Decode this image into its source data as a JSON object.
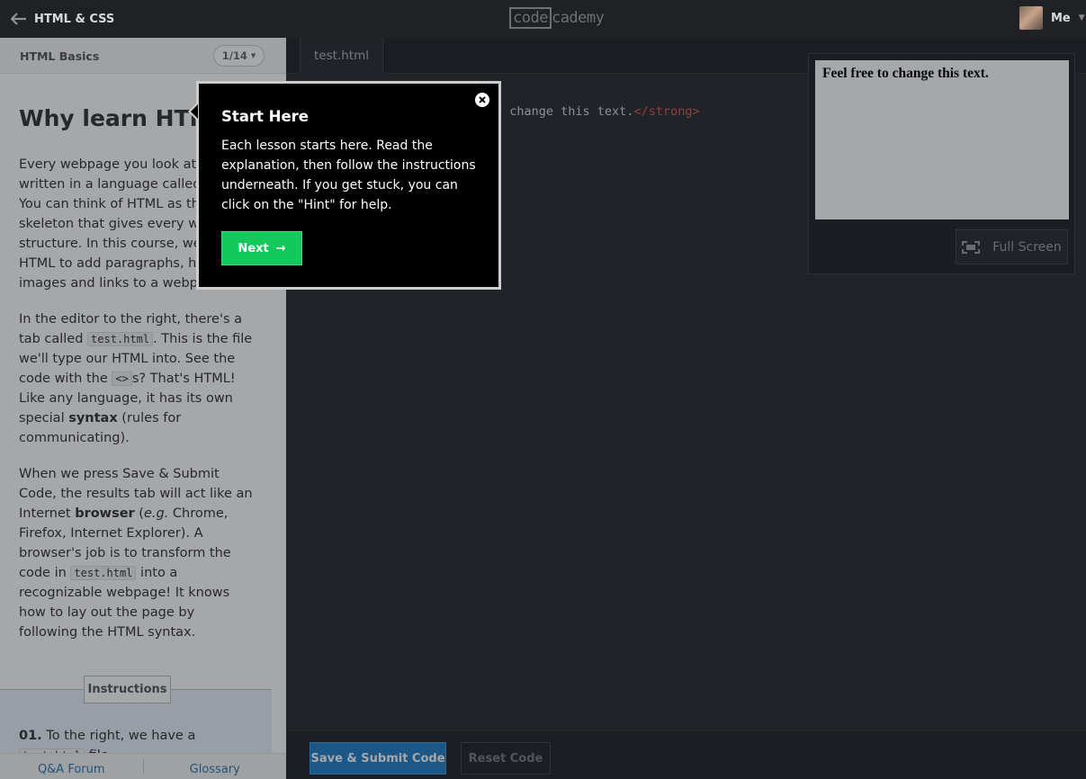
{
  "header": {
    "back_label": "HTML & CSS",
    "logo_left": "code",
    "logo_right": "cademy",
    "user_name": "Me"
  },
  "lesson": {
    "course_title": "HTML Basics",
    "pager": "1/14",
    "heading": "Why learn HTML?",
    "p1": "Every webpage you look at is written in a language called HTML. You can think of HTML as the skeleton that gives every webpage structure. In this course, we'll use HTML to add paragraphs, headings, images and links to a webpage.",
    "p2_a": "In the editor to the right, there's a tab called ",
    "p2_code1": "test.html",
    "p2_b": ". This is the file we'll type our HTML into. See the code with the ",
    "p2_code2": "<>",
    "p2_c": "s? That's HTML! Like any language, it has its own special ",
    "p2_bold": "syntax",
    "p2_d": " (rules for communicating).",
    "p3_a": "When we press Save & Submit Code, the results tab will act like an Internet ",
    "p3_bold": "browser",
    "p3_b": " (",
    "p3_italic": "e.g.",
    "p3_c": " Chrome, Firefox, Internet Explorer). A browser's job is to transform the code in ",
    "p3_code": "test.html",
    "p3_d": " into a recognizable webpage! It knows how to lay out the page by following the HTML syntax.",
    "instructions_label": "Instructions",
    "instr_num": "01.",
    "instr_a": " To the right, we have a ",
    "instr_code": "test.html",
    "instr_b": " file.",
    "footer_forum": "Q&A Forum",
    "footer_glossary": "Glossary"
  },
  "editor": {
    "tab_label": "test.html",
    "code_visible": "o change this text.",
    "code_close_tag": "</strong>"
  },
  "results": {
    "preview_text": "Feel free to change this text.",
    "fullscreen_label": "Full Screen"
  },
  "toolbar": {
    "submit_label": "Save & Submit Code",
    "reset_label": "Reset Code"
  },
  "tooltip": {
    "title": "Start Here",
    "body": "Each lesson starts here. Read the explanation, then follow the instructions underneath. If you get stuck, you can click on the \"Hint\" for help.",
    "next_label": "Next",
    "next_arrow": "→"
  },
  "colors": {
    "accent_blue": "#1f7ec8",
    "accent_green": "#13c95c",
    "code_tag": "#e2564b"
  }
}
